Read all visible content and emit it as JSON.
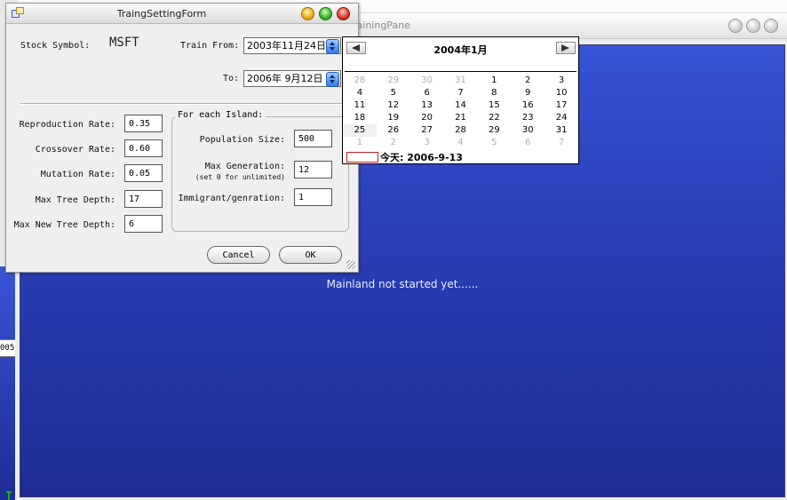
{
  "background_window": {
    "title": "TrainingPane",
    "title_visible": "rainingPane",
    "message": "Mainland not started yet......",
    "left_sliver_field": "005"
  },
  "dialog": {
    "title": "TraingSettingForm",
    "stock_symbol_label": "Stock Symbol:",
    "stock_symbol_value": "MSFT",
    "train_from_label": "Train From:",
    "train_from_value": "2003年11月24日",
    "to_label": "To:",
    "to_value": "2006年 9月12日",
    "reproduction_rate_label": "Reproduction Rate:",
    "reproduction_rate_value": "0.35",
    "crossover_rate_label": "Crossover Rate:",
    "crossover_rate_value": "0.60",
    "mutation_rate_label": "Mutation Rate:",
    "mutation_rate_value": "0.05",
    "max_tree_depth_label": "Max Tree Depth:",
    "max_tree_depth_value": "17",
    "max_new_tree_depth_label": "Max New Tree Depth:",
    "max_new_tree_depth_value": "6",
    "island_group_label": "For each Island:",
    "population_size_label": "Population Size:",
    "population_size_value": "500",
    "max_generation_label": "Max Generation:",
    "max_generation_hint": "(set 0 for unlimited)",
    "max_generation_value": "12",
    "immigrant_label": "Immigrant/genration:",
    "immigrant_value": "1",
    "cancel_label": "Cancel",
    "ok_label": "OK"
  },
  "calendar": {
    "month_title": "2004年1月",
    "weeks": [
      [
        {
          "d": "28",
          "m": true
        },
        {
          "d": "29",
          "m": true
        },
        {
          "d": "30",
          "m": true
        },
        {
          "d": "31",
          "m": true
        },
        {
          "d": "1"
        },
        {
          "d": "2"
        },
        {
          "d": "3"
        }
      ],
      [
        {
          "d": "4"
        },
        {
          "d": "5"
        },
        {
          "d": "6"
        },
        {
          "d": "7"
        },
        {
          "d": "8"
        },
        {
          "d": "9"
        },
        {
          "d": "10"
        }
      ],
      [
        {
          "d": "11"
        },
        {
          "d": "12"
        },
        {
          "d": "13"
        },
        {
          "d": "14"
        },
        {
          "d": "15"
        },
        {
          "d": "16"
        },
        {
          "d": "17"
        }
      ],
      [
        {
          "d": "18"
        },
        {
          "d": "19"
        },
        {
          "d": "20"
        },
        {
          "d": "21"
        },
        {
          "d": "22"
        },
        {
          "d": "23"
        },
        {
          "d": "24"
        }
      ],
      [
        {
          "d": "25",
          "sel": true
        },
        {
          "d": "26"
        },
        {
          "d": "27"
        },
        {
          "d": "28"
        },
        {
          "d": "29"
        },
        {
          "d": "30"
        },
        {
          "d": "31"
        }
      ],
      [
        {
          "d": "1",
          "m": true
        },
        {
          "d": "2",
          "m": true
        },
        {
          "d": "3",
          "m": true
        },
        {
          "d": "4",
          "m": true
        },
        {
          "d": "5",
          "m": true
        },
        {
          "d": "6",
          "m": true
        },
        {
          "d": "7",
          "m": true
        }
      ]
    ],
    "today_label": "今天: 2006-9-13"
  },
  "colors": {
    "pane_gradient_top": "#3654d6",
    "pane_gradient_bottom": "#1f2c93",
    "today_box": "#c02020",
    "spin_blue": "#2f78e8"
  },
  "icons": {
    "dialog_app": "window-app-icon",
    "prev_month": "arrow-left-icon",
    "next_month": "arrow-right-icon",
    "spinner": "spinner-arrows-icon"
  }
}
